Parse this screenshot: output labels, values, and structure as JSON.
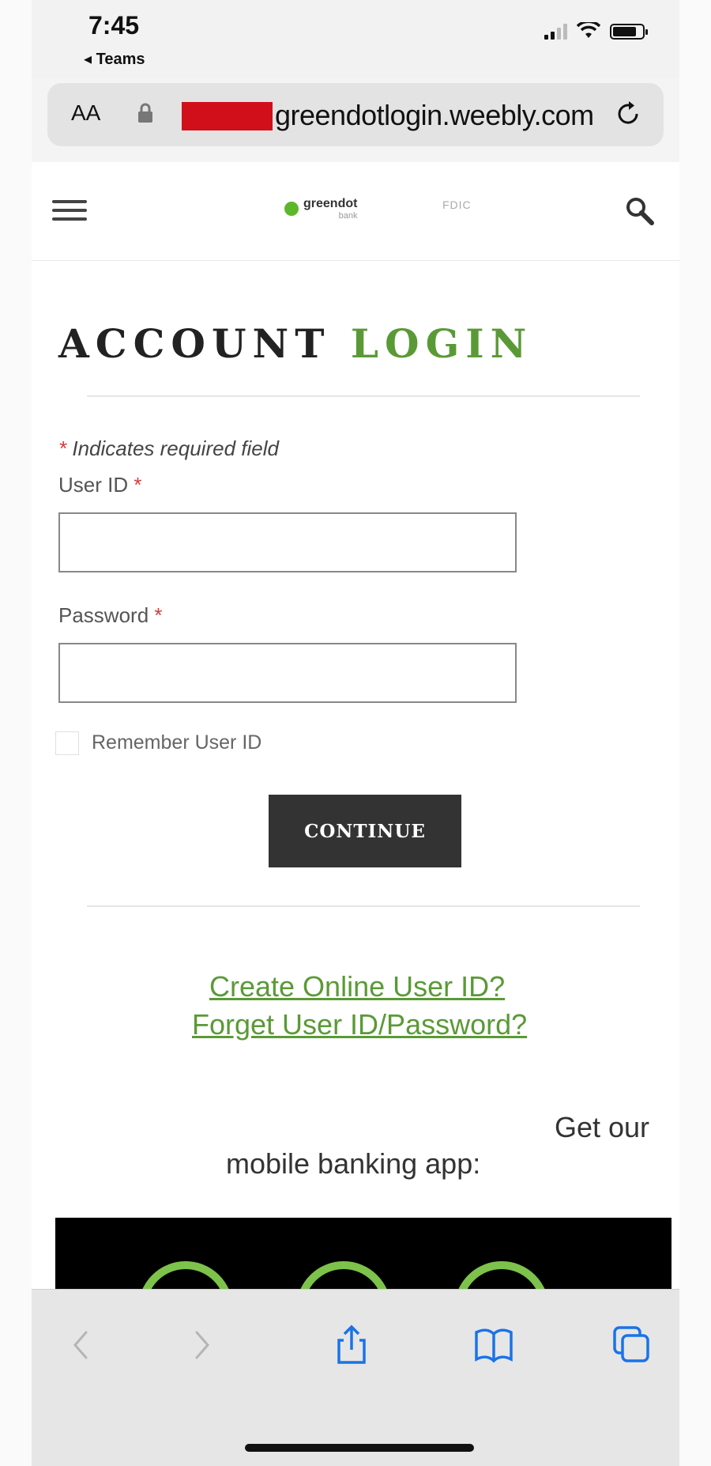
{
  "status_bar": {
    "time": "7:45",
    "back_app": "◂ Teams"
  },
  "address_bar": {
    "text_size_label": "AA",
    "url": "greendotlogin.weebly.com"
  },
  "site_header": {
    "logo_text": "greendot",
    "logo_sub": "bank",
    "badge_text": "FDIC"
  },
  "login": {
    "title_part1": "ACCOUNT",
    "title_part2": "LOGIN",
    "required_star": "*",
    "required_note": " Indicates required field",
    "user_id_label": "User ID",
    "password_label": "Password",
    "remember_label": "Remember User ID",
    "continue_label": "CONTINUE"
  },
  "links": {
    "create_user_id": "Create Online User ID?",
    "forget_credentials": "Forget User ID/Password?"
  },
  "promo": {
    "line1": "Get our",
    "line2": "mobile banking app:"
  },
  "colors": {
    "brand_green": "#5a9a36",
    "button_dark": "#333333",
    "redaction": "#d10f1a"
  },
  "toolbar_icons": [
    "back-icon",
    "forward-icon",
    "share-icon",
    "bookmarks-icon",
    "tabs-icon"
  ]
}
